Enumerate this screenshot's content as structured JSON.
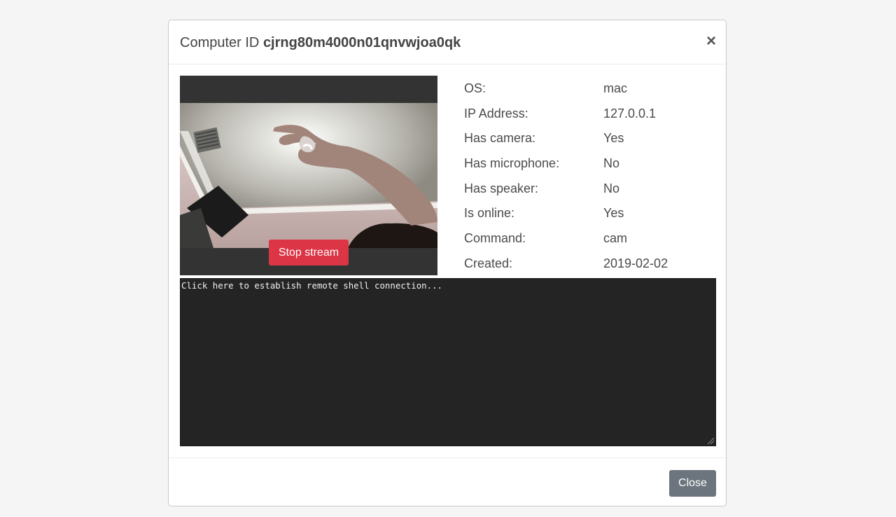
{
  "modal": {
    "title_prefix": "Computer ID",
    "computer_id": "cjrng80m4000n01qnvwjoa0qk",
    "close_x": "×"
  },
  "stream": {
    "stop_label": "Stop stream"
  },
  "info": [
    {
      "label": "OS:",
      "value": "mac"
    },
    {
      "label": "IP Address:",
      "value": "127.0.0.1"
    },
    {
      "label": "Has camera:",
      "value": "Yes"
    },
    {
      "label": "Has microphone:",
      "value": "No"
    },
    {
      "label": "Has speaker:",
      "value": "No"
    },
    {
      "label": "Is online:",
      "value": "Yes"
    },
    {
      "label": "Command:",
      "value": "cam"
    },
    {
      "label": "Created:",
      "value": "2019-02-02"
    }
  ],
  "terminal": {
    "prompt_text": "Click here to establish remote shell connection..."
  },
  "footer": {
    "close_label": "Close"
  },
  "colors": {
    "danger": "#dc3545",
    "secondary": "#6c757d",
    "terminal_bg": "#242424"
  }
}
